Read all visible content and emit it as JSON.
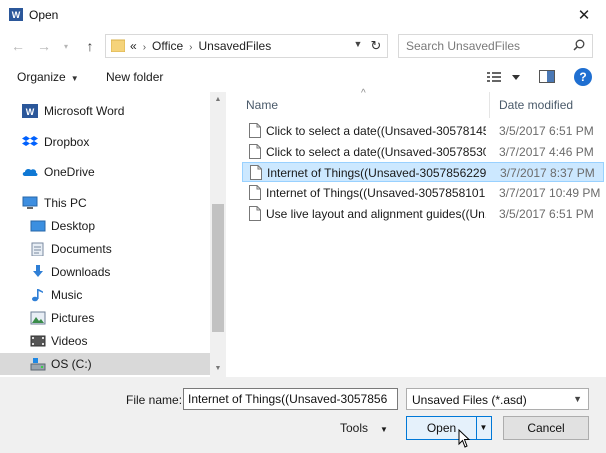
{
  "window": {
    "title": "Open"
  },
  "address": {
    "overflow": "«",
    "crumbs": [
      "Office",
      "UnsavedFiles"
    ]
  },
  "search": {
    "placeholder": "Search UnsavedFiles"
  },
  "toolbar": {
    "organize": "Organize",
    "new_folder": "New folder",
    "help": "?"
  },
  "nav": {
    "items": [
      {
        "label": "Microsoft Word",
        "icon": "word-icon"
      },
      {
        "label": "Dropbox",
        "icon": "dropbox-icon"
      },
      {
        "label": "OneDrive",
        "icon": "onedrive-icon"
      },
      {
        "label": "This PC",
        "icon": "computer-icon"
      },
      {
        "label": "Desktop",
        "icon": "desktop-icon"
      },
      {
        "label": "Documents",
        "icon": "documents-icon"
      },
      {
        "label": "Downloads",
        "icon": "downloads-icon"
      },
      {
        "label": "Music",
        "icon": "music-icon"
      },
      {
        "label": "Pictures",
        "icon": "pictures-icon"
      },
      {
        "label": "Videos",
        "icon": "videos-icon"
      },
      {
        "label": "OS (C:)",
        "icon": "drive-icon"
      }
    ]
  },
  "files": {
    "columns": {
      "name": "Name",
      "date": "Date modified"
    },
    "rows": [
      {
        "name": "Click to select a date((Unsaved-30578145...",
        "date": "3/5/2017 6:51 PM"
      },
      {
        "name": "Click to select a date((Unsaved-30578530...",
        "date": "3/7/2017 4:46 PM"
      },
      {
        "name": "Internet of Things((Unsaved-3057856229...",
        "date": "3/7/2017 8:37 PM"
      },
      {
        "name": "Internet of Things((Unsaved-3057858101...",
        "date": "3/7/2017 10:49 PM"
      },
      {
        "name": "Use live layout and alignment guides((Un...",
        "date": "3/5/2017 6:51 PM"
      }
    ]
  },
  "bottom": {
    "file_name_label": "File name:",
    "file_name_value": "Internet of Things((Unsaved-3057856",
    "filter": "Unsaved Files (*.asd)",
    "tools": "Tools",
    "open": "Open",
    "cancel": "Cancel"
  },
  "colors": {
    "accent": "#0078d7",
    "selection": "#cce8ff",
    "help": "#1f6fd1"
  }
}
